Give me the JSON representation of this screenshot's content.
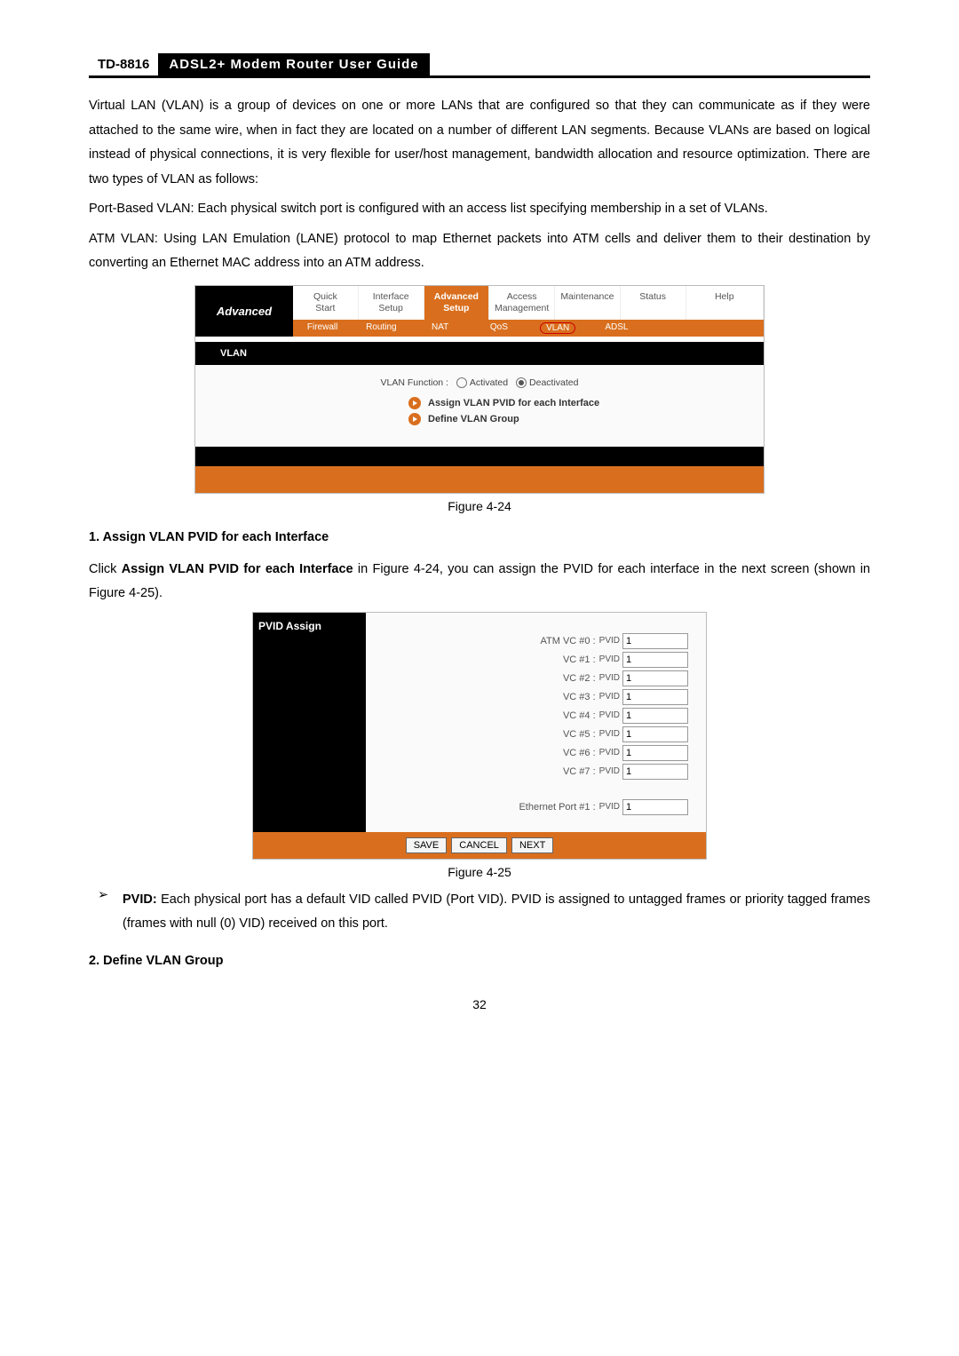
{
  "header": {
    "model": "TD-8816",
    "title": "ADSL2+  Modem  Router  User  Guide"
  },
  "para1": "Virtual LAN (VLAN) is a group of devices on one or more LANs that are configured so that they can communicate as if they were attached to the same wire, when in fact they are located on a number of different LAN segments. Because VLANs are based on logical instead of physical connections, it is very flexible for user/host management, bandwidth allocation and resource optimization. There are two types of VLAN as follows:",
  "para2": "Port-Based VLAN: Each physical switch port is configured with an access list specifying membership in a set of VLANs.",
  "para3": "ATM VLAN: Using LAN Emulation (LANE) protocol to map Ethernet packets into ATM cells and deliver them to their destination by converting an Ethernet MAC address into an ATM address.",
  "fig24": {
    "sidebar": "Advanced",
    "tabs": [
      "Quick\nStart",
      "Interface\nSetup",
      "Advanced\nSetup",
      "Access\nManagement",
      "Maintenance",
      "Status",
      "Help"
    ],
    "subtabs": [
      "Firewall",
      "Routing",
      "NAT",
      "QoS",
      "VLAN",
      "ADSL"
    ],
    "band": "VLAN",
    "vfn_label": "VLAN Function :",
    "opt_a": "Activated",
    "opt_d": "Deactivated",
    "link1": "Assign VLAN PVID for each Interface",
    "link2": "Define VLAN Group",
    "caption": "Figure 4-24"
  },
  "sec1_title": "1.    Assign VLAN PVID for each Interface",
  "sec1_run_a": "Click ",
  "sec1_run_b": "Assign VLAN PVID for each Interface",
  "sec1_run_c": " in Figure 4-24, you can assign the PVID for each interface in the next screen (shown in Figure 4-25).",
  "fig25": {
    "side": "PVID Assign",
    "rows": [
      {
        "label": "ATM VC #0 :",
        "unit": "PVID",
        "val": "1"
      },
      {
        "label": "VC #1 :",
        "unit": "PVID",
        "val": "1"
      },
      {
        "label": "VC #2 :",
        "unit": "PVID",
        "val": "1"
      },
      {
        "label": "VC #3 :",
        "unit": "PVID",
        "val": "1"
      },
      {
        "label": "VC #4 :",
        "unit": "PVID",
        "val": "1"
      },
      {
        "label": "VC #5 :",
        "unit": "PVID",
        "val": "1"
      },
      {
        "label": "VC #6 :",
        "unit": "PVID",
        "val": "1"
      },
      {
        "label": "VC #7 :",
        "unit": "PVID",
        "val": "1"
      }
    ],
    "eth": {
      "label": "Ethernet Port #1 :",
      "unit": "PVID",
      "val": "1"
    },
    "btn_save": "SAVE",
    "btn_cancel": "CANCEL",
    "btn_next": "NEXT",
    "caption": "Figure 4-25"
  },
  "bullet_lead": "PVID:",
  "bullet_body": " Each physical port has a default VID called PVID (Port VID). PVID is assigned to untagged frames or priority tagged frames (frames with null (0) VID) received on this port.",
  "sec2_title": "2.    Define VLAN Group",
  "page": "32"
}
